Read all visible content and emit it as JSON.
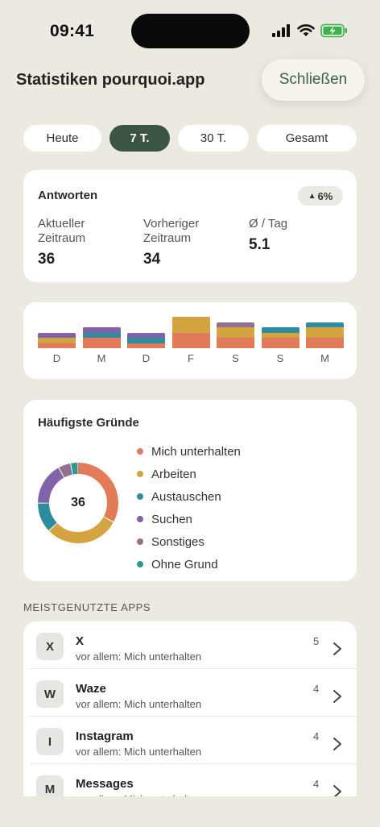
{
  "status_bar": {
    "time": "09:41"
  },
  "header": {
    "title": "Statistiken pourquoi.app",
    "close_label": "Schließen"
  },
  "ranges": [
    {
      "label": "Heute",
      "active": false
    },
    {
      "label": "7 T.",
      "active": true
    },
    {
      "label": "30 T.",
      "active": false
    },
    {
      "label": "Gesamt",
      "active": false
    }
  ],
  "answers": {
    "title": "Antworten",
    "trend": "6%",
    "metrics": [
      {
        "label": "Aktueller\nZeitraum",
        "value": "36"
      },
      {
        "label": "Vorheriger\nZeitraum",
        "value": "34"
      },
      {
        "label": "Ø / Tag",
        "value": "5.1"
      }
    ]
  },
  "colors": {
    "unterhalten": "#E17B5A",
    "arbeiten": "#D4A440",
    "austauschen": "#2E8C9E",
    "suchen": "#8063A8",
    "sonstiges": "#937090",
    "ohne_grund": "#2C9A88",
    "accent": "#3B5443"
  },
  "chart_data": {
    "type": "bar",
    "stacked": true,
    "categories": [
      "D",
      "M",
      "D",
      "F",
      "S",
      "S",
      "M"
    ],
    "series": [
      {
        "name": "Mich unterhalten",
        "values": [
          1,
          2,
          1,
          3,
          2,
          2,
          2
        ]
      },
      {
        "name": "Arbeiten",
        "values": [
          1,
          0,
          0,
          3,
          2,
          1,
          2
        ]
      },
      {
        "name": "Austauschen",
        "values": [
          0,
          1,
          1,
          0,
          0,
          1,
          1
        ]
      },
      {
        "name": "Suchen",
        "values": [
          1,
          1,
          1,
          0,
          0,
          0,
          0
        ]
      },
      {
        "name": "Sonstiges",
        "values": [
          0,
          0,
          0,
          0,
          1,
          0,
          0
        ]
      },
      {
        "name": "Ohne Grund",
        "values": [
          0,
          0,
          0,
          0,
          0,
          0,
          0
        ]
      }
    ]
  },
  "reasons": {
    "title": "Häufigste Gründe",
    "total": "36",
    "items": [
      {
        "label": "Mich unterhalten",
        "key": "unterhalten",
        "share": 0.33
      },
      {
        "label": "Arbeiten",
        "key": "arbeiten",
        "share": 0.3
      },
      {
        "label": "Austauschen",
        "key": "austauschen",
        "share": 0.12
      },
      {
        "label": "Suchen",
        "key": "suchen",
        "share": 0.17
      },
      {
        "label": "Sonstiges",
        "key": "sonstiges",
        "share": 0.05
      },
      {
        "label": "Ohne Grund",
        "key": "ohne_grund",
        "share": 0.03
      }
    ]
  },
  "apps_section": {
    "title": "MEISTGENUTZTE APPS",
    "apps": [
      {
        "initial": "X",
        "name": "X",
        "sub": "vor allem: Mich unterhalten",
        "count": "5"
      },
      {
        "initial": "W",
        "name": "Waze",
        "sub": "vor allem: Mich unterhalten",
        "count": "4"
      },
      {
        "initial": "I",
        "name": "Instagram",
        "sub": "vor allem: Mich unterhalten",
        "count": "4"
      },
      {
        "initial": "M",
        "name": "Messages",
        "sub": "vor allem: Mich unterhalten",
        "count": "4"
      }
    ]
  }
}
